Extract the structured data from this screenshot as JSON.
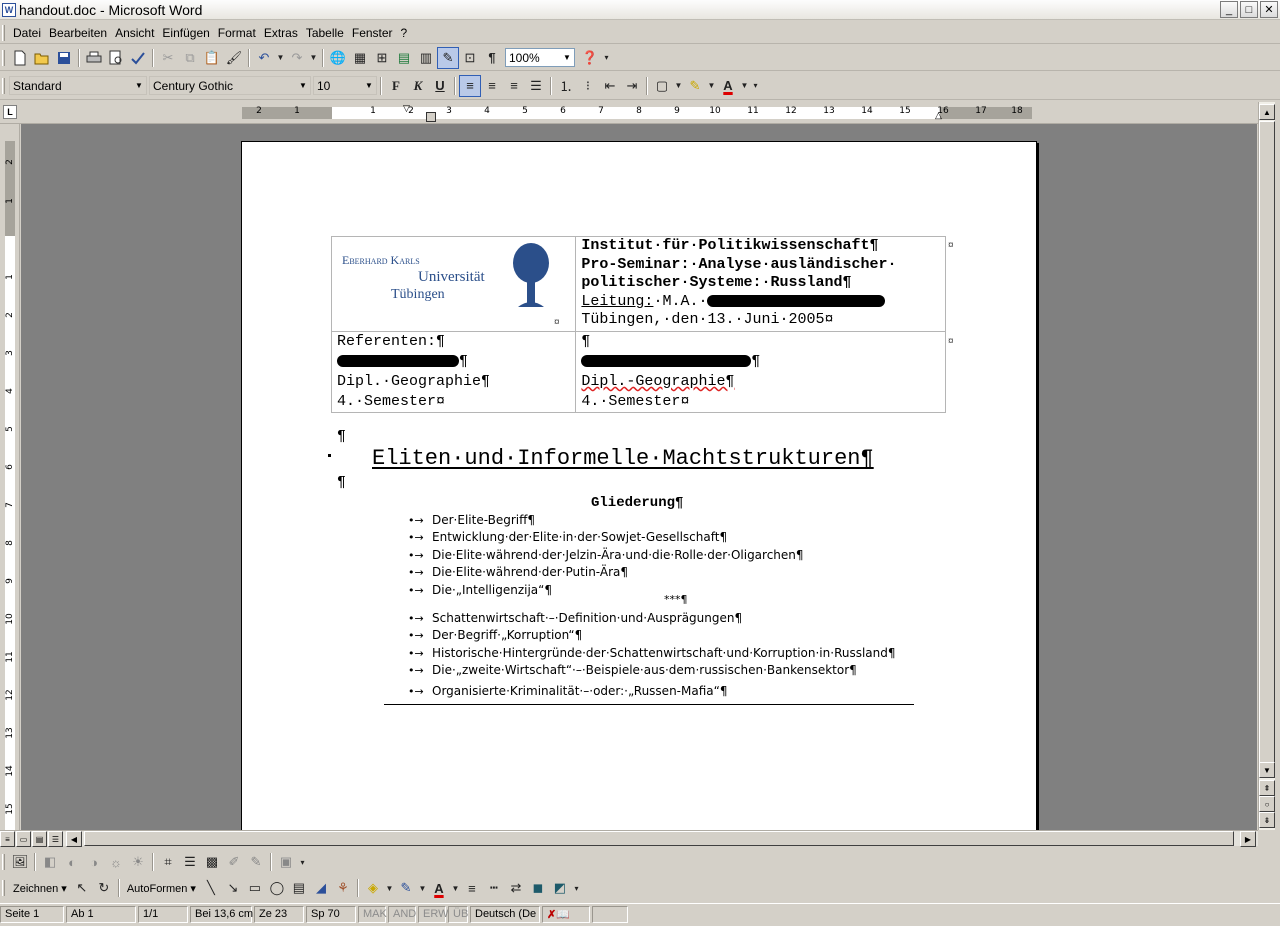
{
  "window": {
    "title": "handout.doc - Microsoft Word",
    "buttons": [
      "_",
      "□",
      "✕"
    ]
  },
  "menu": [
    "Datei",
    "Bearbeiten",
    "Ansicht",
    "Einfügen",
    "Format",
    "Extras",
    "Tabelle",
    "Fenster",
    "?"
  ],
  "toolbar": {
    "zoom": "100%"
  },
  "format": {
    "style": "Standard",
    "font": "Century Gothic",
    "size": "10"
  },
  "ruler_h": [
    "2",
    "1",
    "1",
    "2",
    "3",
    "4",
    "5",
    "6",
    "7",
    "8",
    "9",
    "10",
    "11",
    "12",
    "13",
    "14",
    "15",
    "16",
    "17",
    "18"
  ],
  "ruler_v": [
    "2",
    "1",
    "1",
    "2",
    "3",
    "4",
    "5",
    "6",
    "7",
    "8",
    "9",
    "10",
    "11",
    "12",
    "13",
    "14",
    "15"
  ],
  "document": {
    "logo": {
      "line1": "Eberhard Karls",
      "line2": "Universität",
      "line3": "Tübingen"
    },
    "institute": [
      "Institut·für·Politikwissenschaft¶",
      "Pro-Seminar:·Analyse·ausländischer·",
      "politischer·Systeme:·Russland¶",
      "Leitung:·M.A.·",
      "Tübingen,·den·13.·Juni·2005¤"
    ],
    "leitung_label": "Leitung:",
    "leitung_rest": "·M.A.·",
    "ref_left": [
      "Referenten:¶",
      "¶",
      "Dipl.·Geographie¶",
      "4.·Semester¤"
    ],
    "ref_right": [
      "¶",
      "¶",
      "Dipl.-Geographie¶",
      "4.·Semester¤"
    ],
    "pilcrow": "¶",
    "cell_end": "¤",
    "title": "Eliten·und·Informelle·Machtstrukturen¶",
    "outline_heading": "Gliederung¶",
    "outline_part1": [
      "Der·Elite-Begriff¶",
      "Entwicklung·der·Elite·in·der·Sowjet-Gesellschaft¶",
      "Die·Elite·während·der·Jelzin-Ära·und·die·Rolle·der·Oligarchen¶",
      "Die·Elite·während·der·Putin-Ära¶",
      "Die·„Intelligenzija“¶"
    ],
    "separator": "***¶",
    "outline_part2": [
      "Schattenwirtschaft·–·Definition·und·Ausprägungen¶",
      "Der·Begriff·„Korruption“¶",
      "Historische·Hintergründe·der·Schattenwirtschaft·und·Korruption·in·Russland¶",
      "Die·„zweite·Wirtschaft“·–·Beispiele·aus·dem·russischen·Bankensektor¶",
      "Organisierte·Kriminalität·–·oder:·„Russen-Mafia“¶"
    ],
    "bullet": "•→"
  },
  "drawing": {
    "zeichnen": "Zeichnen ▾",
    "autoformen": "AutoFormen ▾"
  },
  "status": {
    "seite": "Seite  1",
    "ab": "Ab  1",
    "pages": "1/1",
    "bei": "Bei  13,6 cm",
    "ze": "Ze  23",
    "sp": "Sp  70",
    "mak": "MAK",
    "and": "AND",
    "erw": "ERW",
    "ub": "ÜB",
    "lang": "Deutsch (De"
  },
  "colors": {
    "accent": "#2b4f8a",
    "page": "#ffffff",
    "workspace": "#808080"
  }
}
